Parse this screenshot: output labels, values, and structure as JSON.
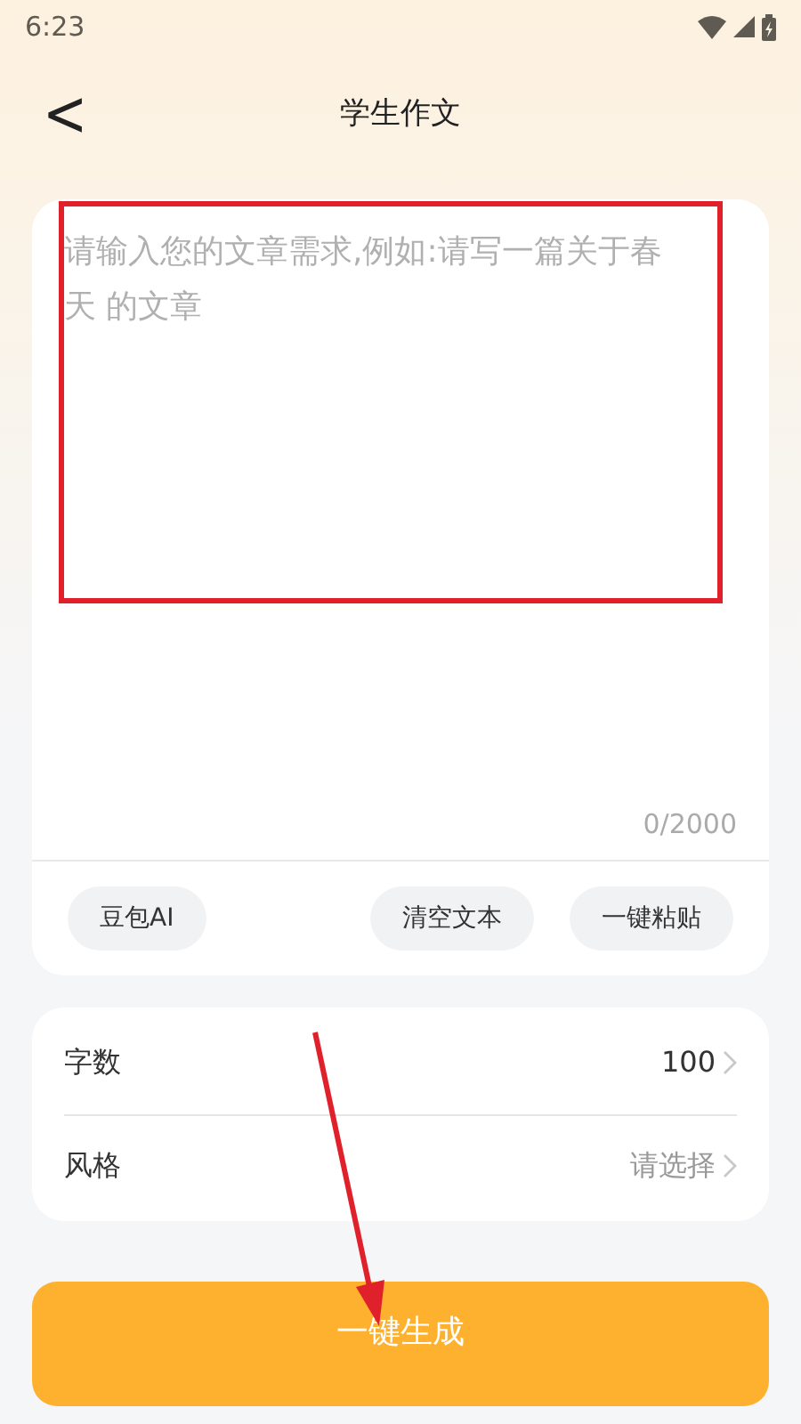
{
  "status_bar": {
    "time": "6:23"
  },
  "header": {
    "back": "<",
    "title": "学生作文"
  },
  "editor": {
    "placeholder": "请输入您的文章需求,例如:请写一篇关于春天 的文章",
    "counter": "0/2000"
  },
  "editor_actions": [
    {
      "label": "豆包AI"
    },
    {
      "label": "清空文本"
    },
    {
      "label": "一键粘贴"
    }
  ],
  "settings": [
    {
      "label": "字数",
      "value": "100",
      "placeholder": false
    },
    {
      "label": "风格",
      "value": "请选择",
      "placeholder": true
    }
  ],
  "submit": {
    "label": "一键生成"
  }
}
